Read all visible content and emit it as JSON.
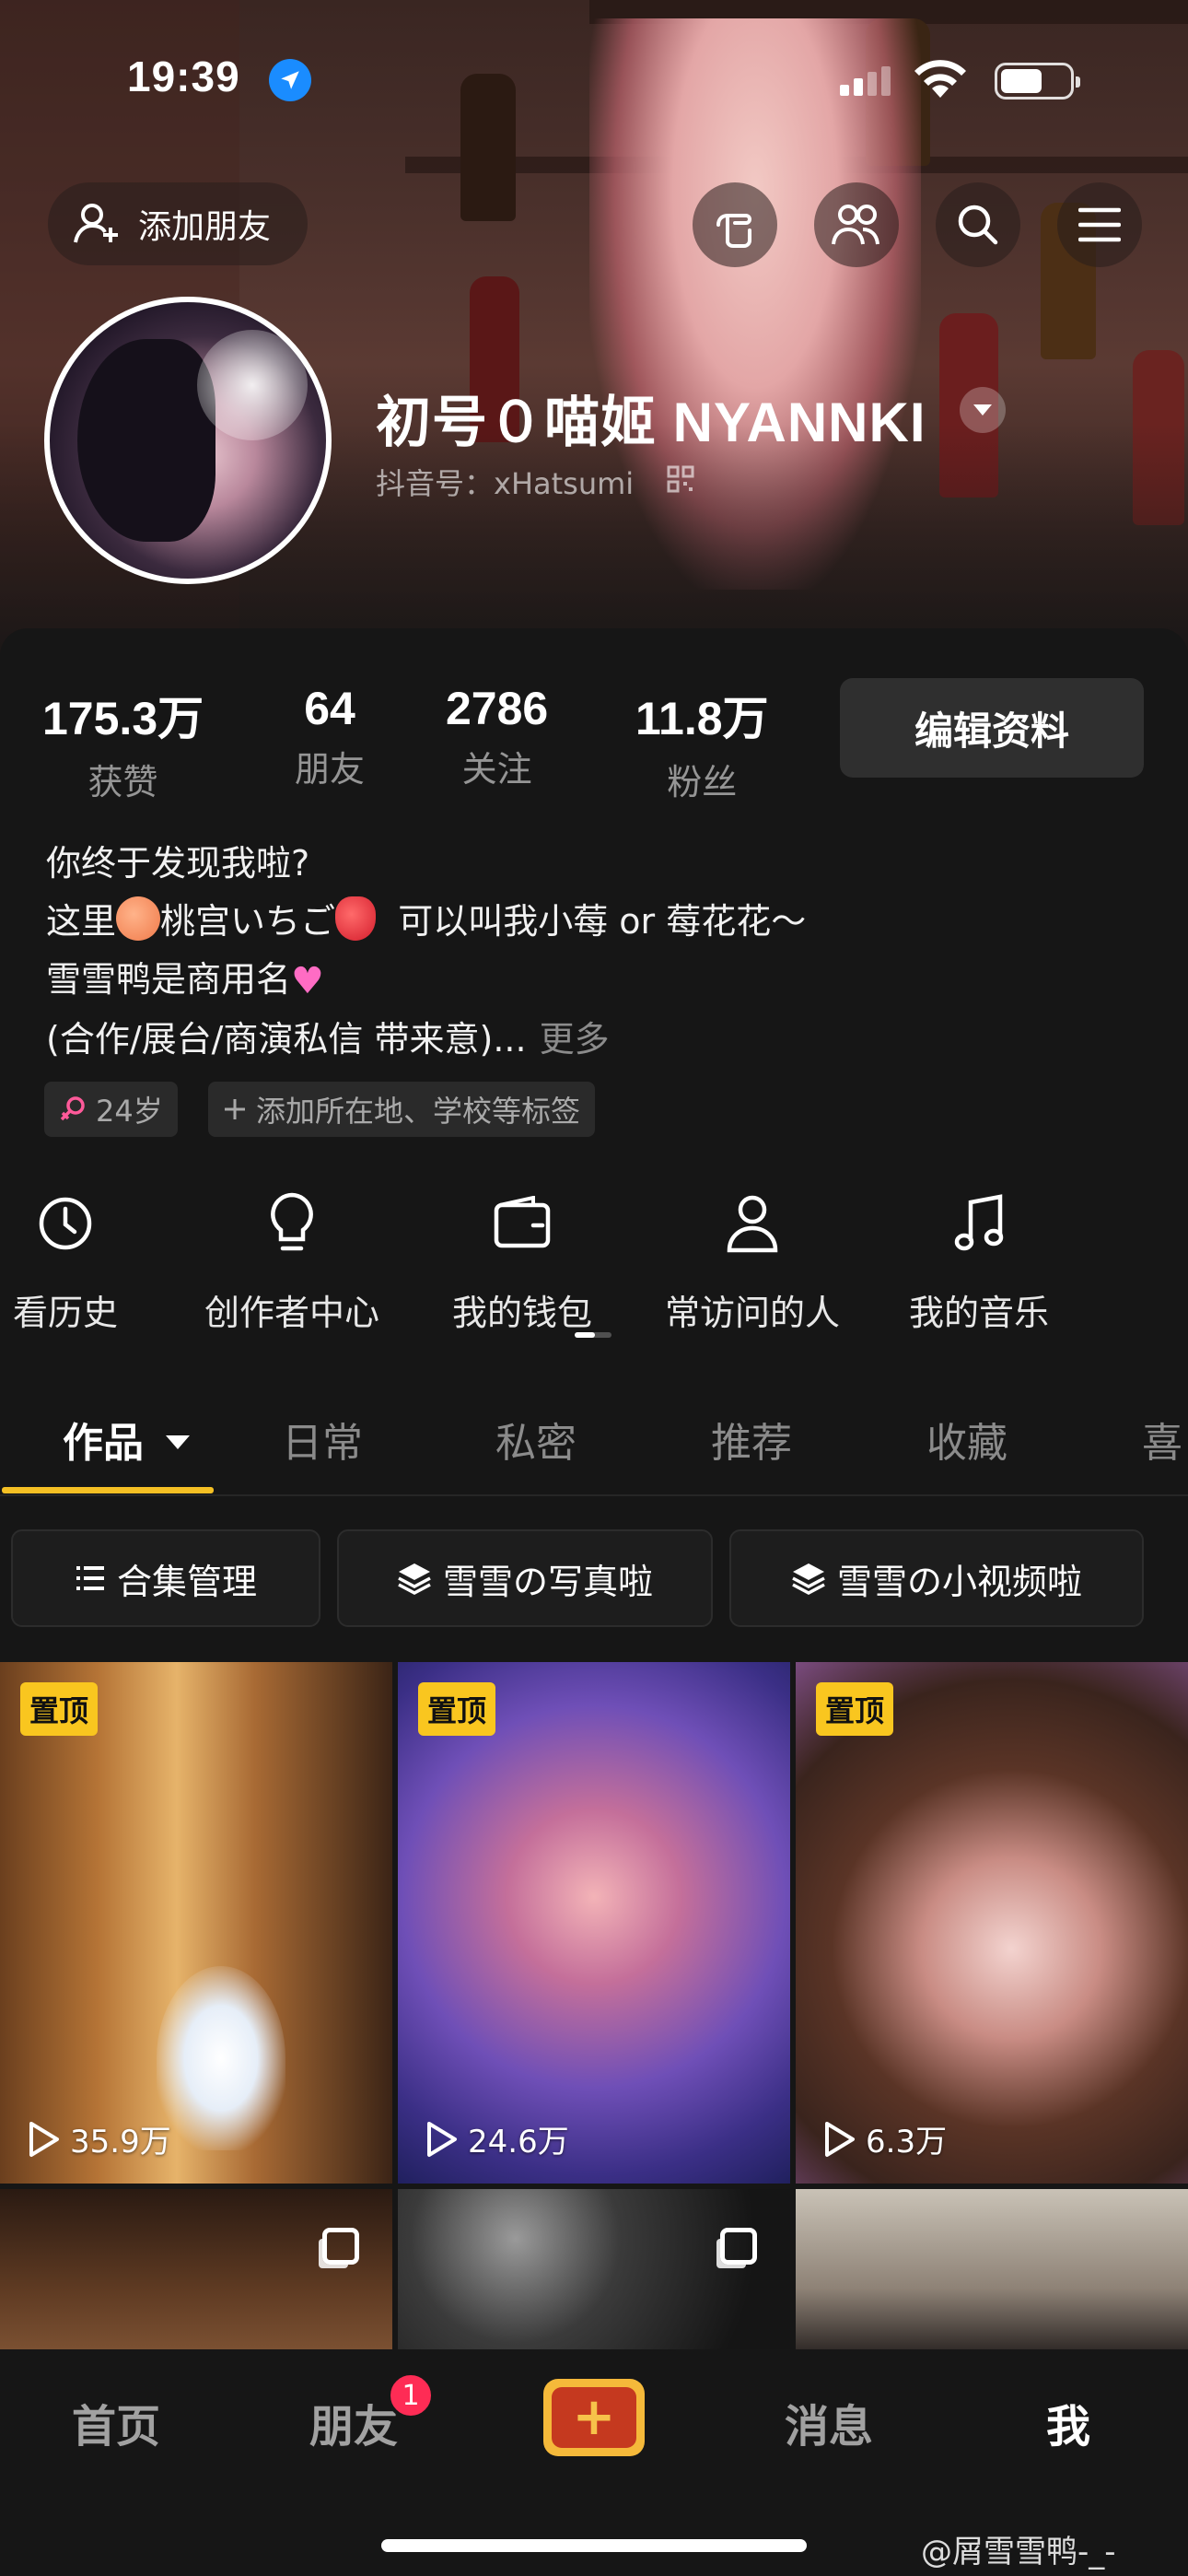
{
  "status_bar": {
    "time": "19:39"
  },
  "header": {
    "add_friend_label": "添加朋友"
  },
  "profile": {
    "nickname": "初号０喵姬 NYANNKI",
    "douyin_id": "抖音号：xHatsumi"
  },
  "stats": [
    {
      "value": "175.3万",
      "label": "获赞"
    },
    {
      "value": "64",
      "label": "朋友"
    },
    {
      "value": "2786",
      "label": "关注"
    },
    {
      "value": "11.8万",
      "label": "粉丝"
    }
  ],
  "edit_profile_label": "编辑资料",
  "bio": {
    "line1": "你终于发现我啦?",
    "line2_a": "这里",
    "line2_b": "桃宫いちご",
    "line2_c": "可以叫我小莓 or 莓花花～",
    "line3": "雪雪鸭是商用名",
    "line4": "(合作/展台/商演私信 带来意)...",
    "more": "更多"
  },
  "tags": {
    "age": "24岁",
    "add_tag": "添加所在地、学校等标签"
  },
  "services": [
    {
      "label": "看历史",
      "icon": "clock-icon"
    },
    {
      "label": "创作者中心",
      "icon": "bulb-icon"
    },
    {
      "label": "我的钱包",
      "icon": "wallet-icon"
    },
    {
      "label": "常访问的人",
      "icon": "person-icon"
    },
    {
      "label": "我的音乐",
      "icon": "music-note-icon"
    }
  ],
  "tabs": [
    "作品",
    "日常",
    "私密",
    "推荐",
    "收藏",
    "喜"
  ],
  "collections": [
    "合集管理",
    "雪雪の写真啦",
    "雪雪の小视频啦"
  ],
  "grid": [
    {
      "pinned_label": "置顶",
      "plays": "35.9万"
    },
    {
      "pinned_label": "置顶",
      "plays": "24.6万"
    },
    {
      "pinned_label": "置顶",
      "plays": "6.3万"
    }
  ],
  "bottom_nav": {
    "home": "首页",
    "friends": "朋友",
    "friends_badge": "1",
    "create": "+",
    "messages": "消息",
    "me": "我"
  },
  "watermark": "@屑雪雪鸭-_-",
  "colors": {
    "accent_yellow": "#f5c024",
    "badge_red": "#fe2c55",
    "background": "#161616"
  }
}
